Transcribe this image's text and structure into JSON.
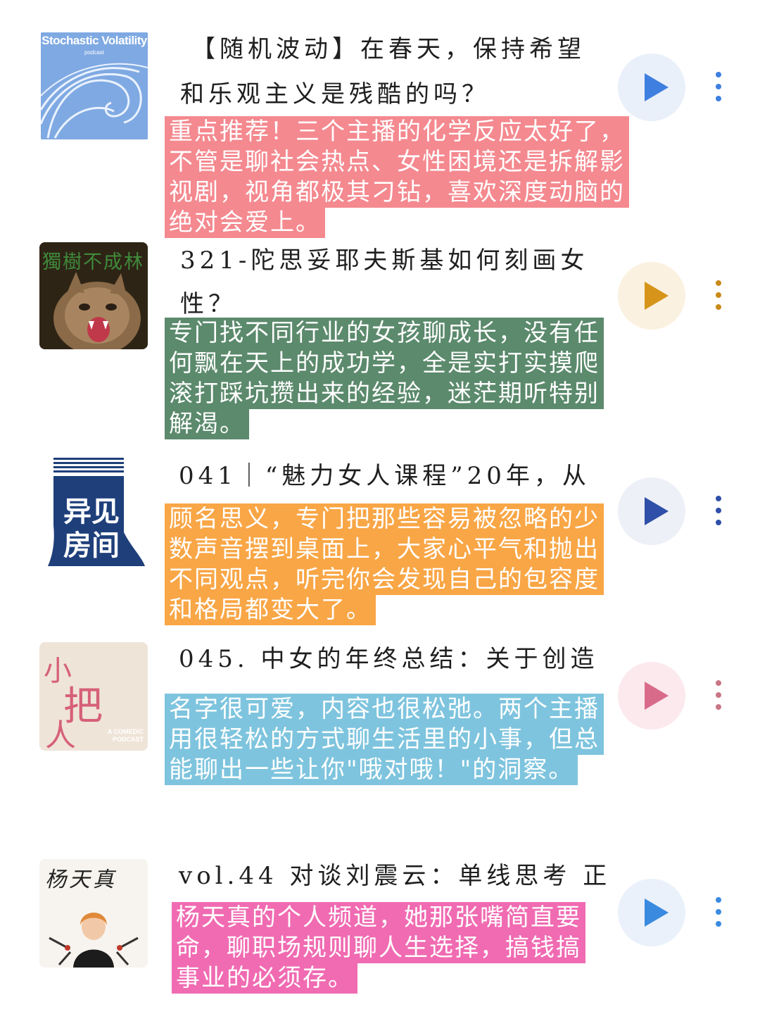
{
  "items": [
    {
      "cover": {
        "text": "Stochastic Volatility",
        "sub": "podcast"
      },
      "title_lines": [
        "【随机波动】在春天，保持希望",
        "和乐观主义是残酷的吗？"
      ],
      "note": "重点推荐！三个主播的化学反应太好了，不管是聊社会热点、女性困境还是拆解影视剧，视角都极其刁钻，喜欢深度动脑的绝对会爱上。",
      "note_color": "#f4898f",
      "play_bg": "#eaf0fa",
      "play_color": "#3f7fe0",
      "dots_color": "#3f7fe0"
    },
    {
      "cover": {
        "text": "獨樹不成林"
      },
      "title_lines": [
        "321-陀思妥耶夫斯基如何刻画女",
        "性？"
      ],
      "note": "专门找不同行业的女孩聊成长，没有任何飘在天上的成功学，全是实打实摸爬滚打踩坑攒出来的经验，迷茫期听特别解渴。",
      "note_color": "#5b8a6c",
      "play_bg": "#fbf1e0",
      "play_color": "#d6951a",
      "dots_color": "#c98a18"
    },
    {
      "cover": {
        "text1": "异见",
        "text2": "房间"
      },
      "title_lines": [
        "041｜“魅力女人课程”20年，从"
      ],
      "note": "顾名思义，专门把那些容易被忽略的少数声音摆到桌面上，大家心平气和抛出不同观点，听完你会发现自己的包容度和格局都变大了。",
      "note_color": "#f9a646",
      "play_bg": "#eef0f7",
      "play_color": "#2f4fa8",
      "dots_color": "#2f4fa8"
    },
    {
      "cover": {
        "text1": "小",
        "text2": "把",
        "text3": "人",
        "sub": "A COMEDIC PODCAST"
      },
      "title_lines": [
        "045. 中女的年终总结：关于创造"
      ],
      "note": "名字很可爱，内容也很松弛。两个主播用很轻松的方式聊生活里的小事，但总能聊出一些让你\"哦对哦！\"的洞察。",
      "note_color": "#7ec4de",
      "play_bg": "#fbe9ee",
      "play_color": "#d96b8a",
      "dots_color": "#c97585"
    },
    {
      "cover": {
        "text": "杨天真"
      },
      "title_lines": [
        "vol.44 对谈刘震云：单线思考 正"
      ],
      "note": "杨天真的个人频道，她那张嘴简直要命，聊职场规则聊人生选择，搞钱搞事业的必须存。",
      "note_color": "#f06bb2",
      "play_bg": "#eaf1fb",
      "play_color": "#3a8ae0",
      "dots_color": "#3a8ae0"
    }
  ]
}
